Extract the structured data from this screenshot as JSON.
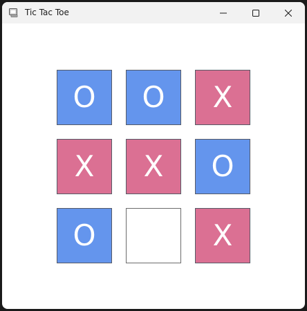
{
  "window": {
    "title": "Tic Tac Toe",
    "icon": "tictactoe-app-icon",
    "controls": [
      "minimize-icon",
      "maximize-icon",
      "close-icon"
    ]
  },
  "colors": {
    "o": "#6495ed",
    "x": "#db7093",
    "empty": "#ffffff",
    "mark_text": "#ffffff"
  },
  "board": {
    "cells": [
      {
        "mark": "O"
      },
      {
        "mark": "O"
      },
      {
        "mark": "X"
      },
      {
        "mark": "X"
      },
      {
        "mark": "X"
      },
      {
        "mark": "O"
      },
      {
        "mark": "O"
      },
      {
        "mark": ""
      },
      {
        "mark": "X"
      }
    ]
  }
}
